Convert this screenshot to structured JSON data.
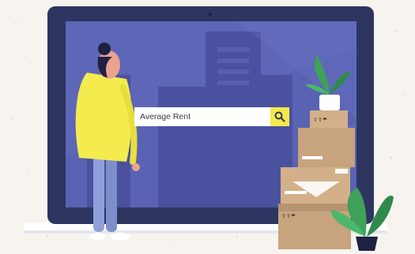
{
  "search": {
    "value": "Average Rent",
    "button_icon": "search-icon"
  },
  "colors": {
    "background": "#f7f3ee",
    "laptop_frame": "#2d3560",
    "screen": "#5a63b3",
    "accent_yellow": "#f4e84a",
    "box_brown": "#c8a47e"
  }
}
